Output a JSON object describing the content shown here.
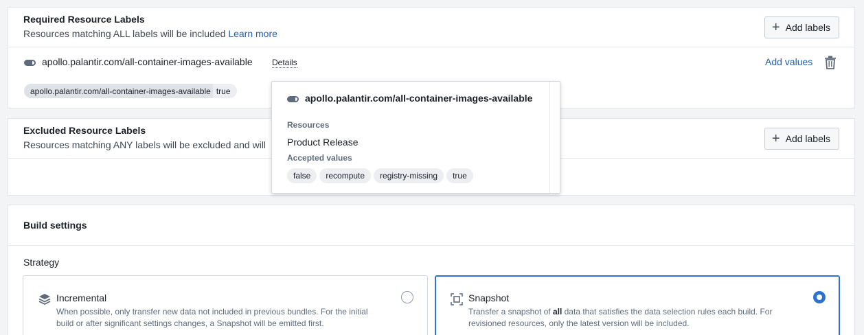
{
  "required": {
    "title": "Required Resource Labels",
    "subtitle": "Resources matching ALL labels will be included",
    "learn_more": "Learn more",
    "add_labels": "Add labels",
    "label": {
      "name": "apollo.palantir.com/all-container-images-available",
      "details": "Details",
      "add_values": "Add values",
      "chip_key": "apollo.palantir.com/all-container-images-available",
      "chip_value": "true"
    }
  },
  "excluded": {
    "title": "Excluded Resource Labels",
    "subtitle": "Resources matching ANY labels will be excluded and will",
    "add_labels": "Add labels"
  },
  "popover": {
    "title": "apollo.palantir.com/all-container-images-available",
    "resources_label": "Resources",
    "resources_value": "Product Release",
    "accepted_label": "Accepted values",
    "accepted_values": [
      "false",
      "recompute",
      "registry-missing",
      "true"
    ]
  },
  "build": {
    "title": "Build settings",
    "strategy_label": "Strategy",
    "options": [
      {
        "title": "Incremental",
        "desc": "When possible, only transfer new data not included in previous bundles. For the initial build or after significant settings changes, a Snapshot will be emitted first.",
        "selected": false
      },
      {
        "title": "Snapshot",
        "desc_pre": "Transfer a snapshot of ",
        "desc_bold": "all",
        "desc_post": " data that satisfies the data selection rules each build. For revisioned resources, only the latest version will be included.",
        "selected": true
      }
    ]
  },
  "colors": {
    "accent": "#2d72d2",
    "link": "#215db0",
    "text": "#1c2127",
    "muted": "#5f6b7c"
  },
  "icons": [
    "plus-icon",
    "tag-icon",
    "trash-icon",
    "layers-icon",
    "snapshot-icon"
  ]
}
